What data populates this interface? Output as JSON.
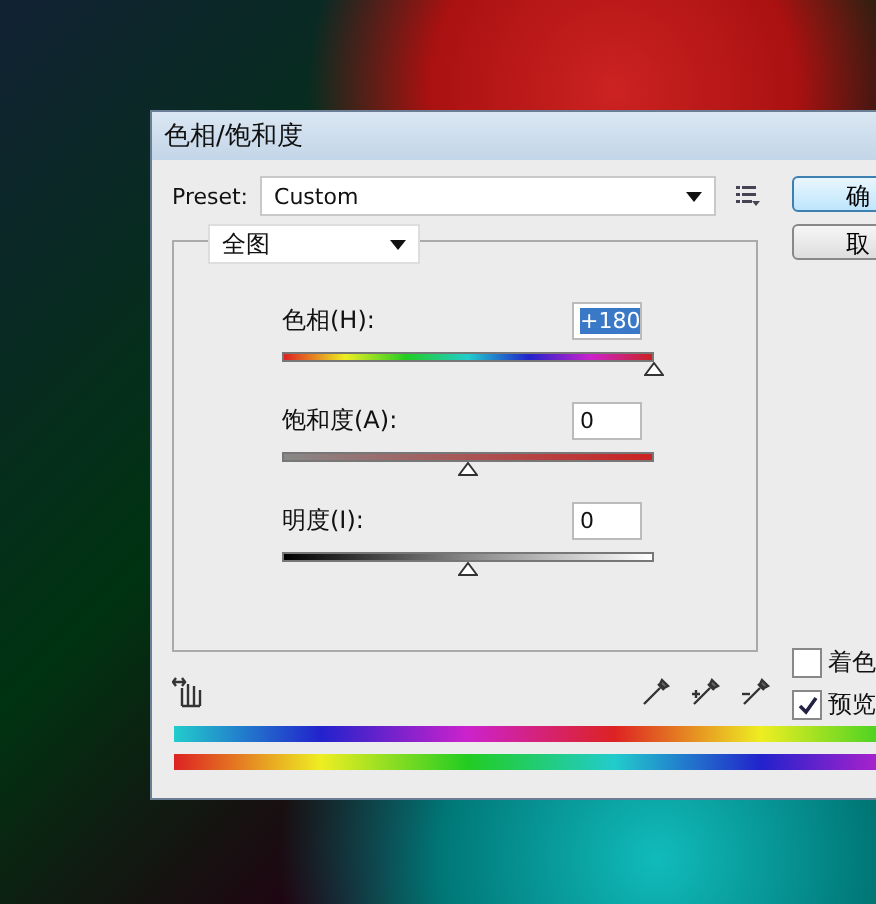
{
  "window": {
    "title": "色相/饱和度"
  },
  "preset": {
    "label": "Preset:",
    "value": "Custom"
  },
  "buttons": [
    {
      "label": "确",
      "kind": "default"
    },
    {
      "label": "取",
      "kind": "normal"
    }
  ],
  "edit": {
    "value": "全图"
  },
  "sliders": [
    {
      "label": "色相(H):",
      "value": "+180",
      "kind": "hue",
      "level": 1.0,
      "selected": true
    },
    {
      "label": "饱和度(A):",
      "value": "0",
      "kind": "saturation",
      "level": 0.5,
      "selected": false
    },
    {
      "label": "明度(I):",
      "value": "0",
      "kind": "lightness",
      "level": 0.5,
      "selected": false
    }
  ],
  "options": [
    {
      "label": "着色",
      "checked": false
    },
    {
      "label": "预览",
      "checked": true
    }
  ]
}
